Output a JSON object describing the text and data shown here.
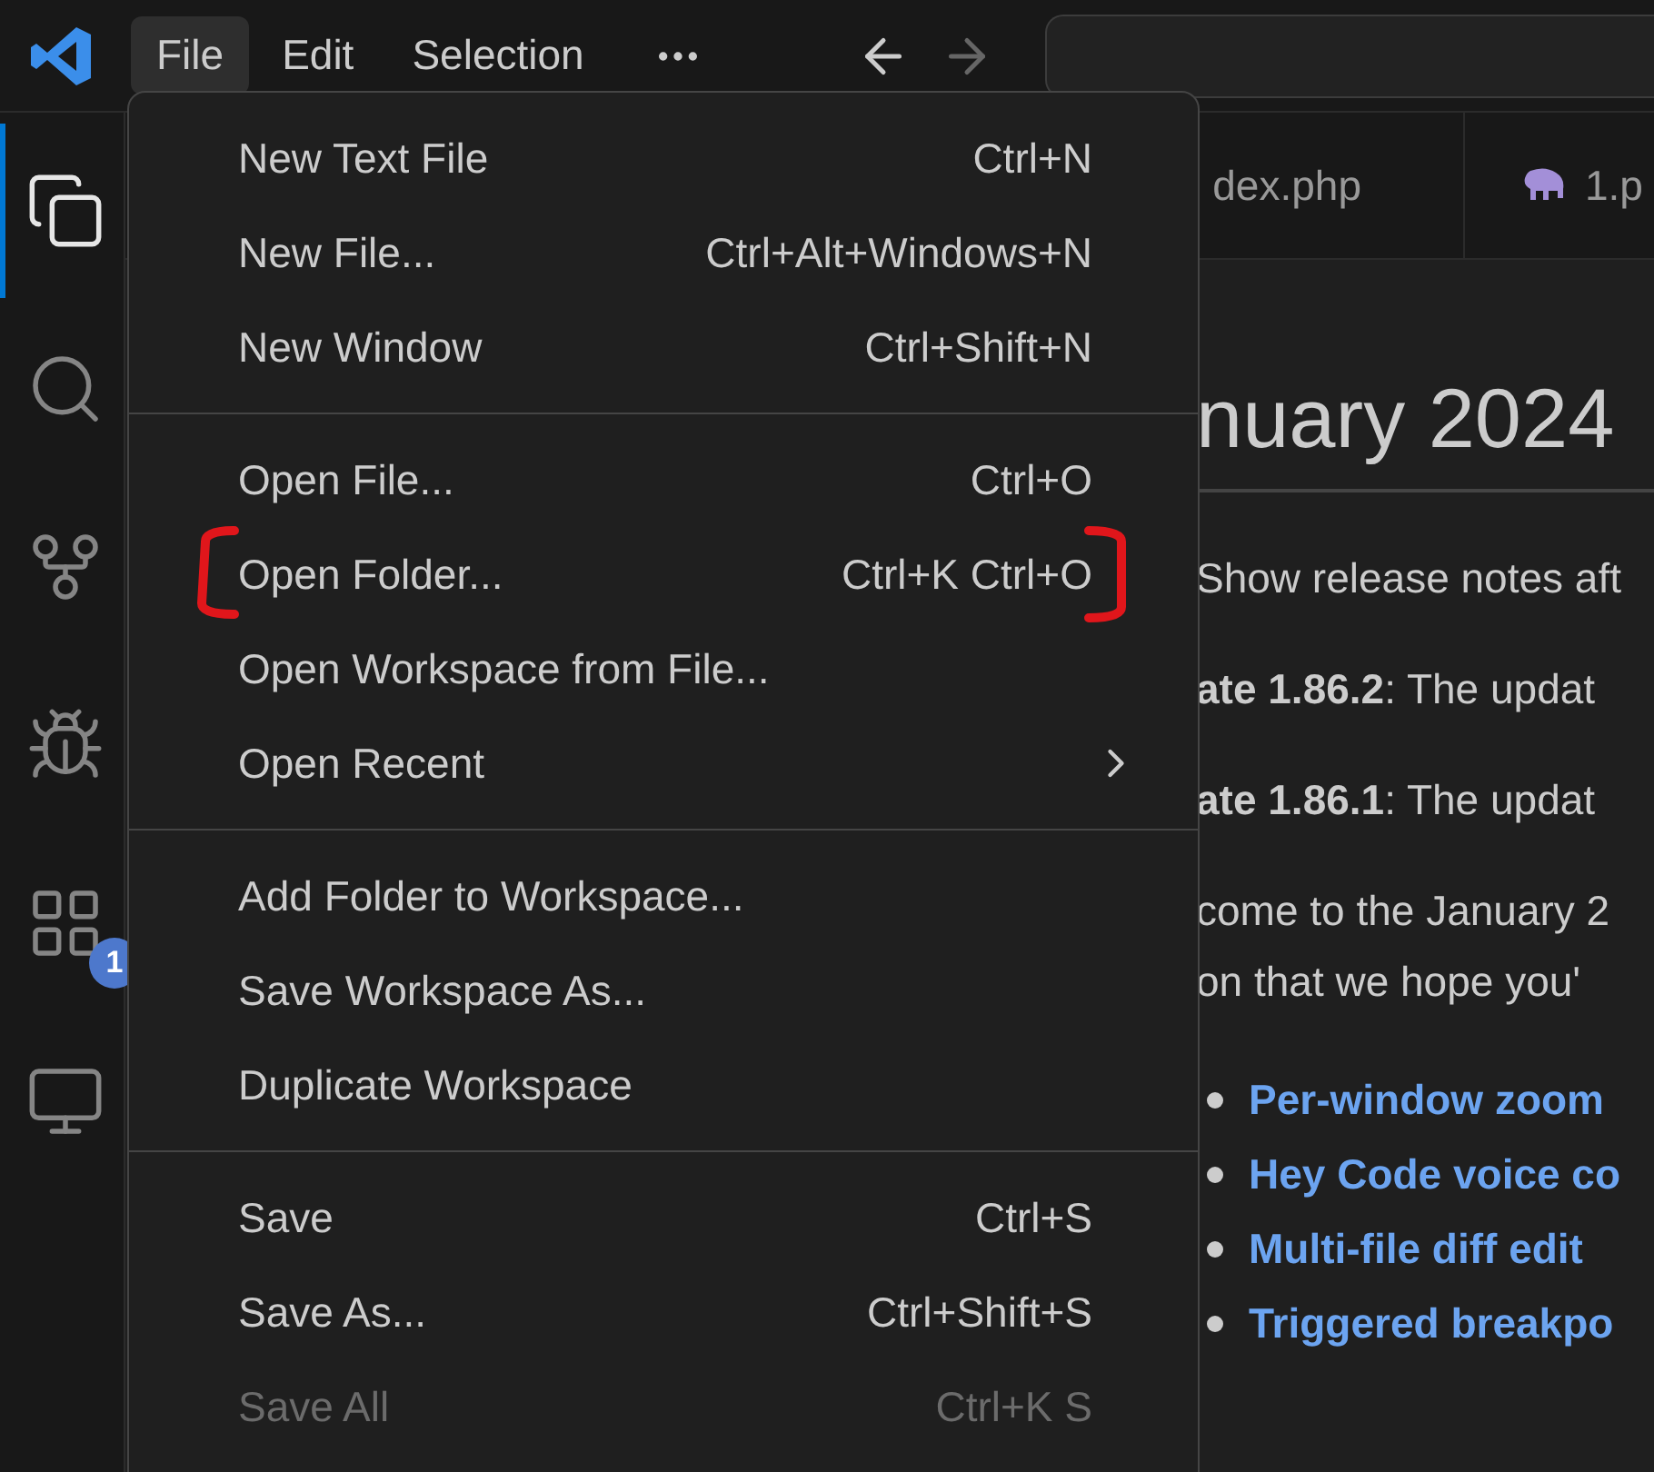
{
  "menubar": [
    {
      "label": "File",
      "selected": true
    },
    {
      "label": "Edit",
      "selected": false
    },
    {
      "label": "Selection",
      "selected": false
    }
  ],
  "activity_bar": {
    "items": [
      {
        "kind": "files",
        "selected": true
      },
      {
        "kind": "search",
        "selected": false
      },
      {
        "kind": "source-control",
        "selected": false
      },
      {
        "kind": "debug",
        "selected": false
      },
      {
        "kind": "extensions",
        "selected": false,
        "badge": "1"
      },
      {
        "kind": "remote",
        "selected": false
      }
    ]
  },
  "tabs": [
    {
      "label": "dex.php",
      "kind": "plain"
    },
    {
      "label": "1.p",
      "kind": "php"
    }
  ],
  "editor": {
    "heading": "nuary 2024",
    "paragraphs": [
      "Show release notes aft",
      "**ate 1.86.2**: The updat",
      "**ate 1.86.1**: The updat"
    ],
    "welcome": [
      "come to the January 2",
      "on that we hope you'"
    ],
    "links": [
      "Per-window zoom",
      "Hey Code voice co",
      "Multi-file diff edit",
      "Triggered breakpo"
    ]
  },
  "file_menu": {
    "groups": [
      [
        {
          "label": "New Text File",
          "shortcut": "Ctrl+N",
          "disabled": false,
          "submenu": false,
          "highlighted": false
        },
        {
          "label": "New File...",
          "shortcut": "Ctrl+Alt+Windows+N",
          "disabled": false,
          "submenu": false,
          "highlighted": false
        },
        {
          "label": "New Window",
          "shortcut": "Ctrl+Shift+N",
          "disabled": false,
          "submenu": false,
          "highlighted": false
        }
      ],
      [
        {
          "label": "Open File...",
          "shortcut": "Ctrl+O",
          "disabled": false,
          "submenu": false,
          "highlighted": false
        },
        {
          "label": "Open Folder...",
          "shortcut": "Ctrl+K Ctrl+O",
          "disabled": false,
          "submenu": false,
          "highlighted": true
        },
        {
          "label": "Open Workspace from File...",
          "disabled": false,
          "submenu": false,
          "highlighted": false
        },
        {
          "label": "Open Recent",
          "disabled": false,
          "submenu": true,
          "highlighted": false
        }
      ],
      [
        {
          "label": "Add Folder to Workspace...",
          "disabled": false,
          "submenu": false,
          "highlighted": false
        },
        {
          "label": "Save Workspace As...",
          "disabled": false,
          "submenu": false,
          "highlighted": false
        },
        {
          "label": "Duplicate Workspace",
          "disabled": false,
          "submenu": false,
          "highlighted": false
        }
      ],
      [
        {
          "label": "Save",
          "shortcut": "Ctrl+S",
          "disabled": false,
          "submenu": false,
          "highlighted": false
        },
        {
          "label": "Save As...",
          "shortcut": "Ctrl+Shift+S",
          "disabled": false,
          "submenu": false,
          "highlighted": false
        },
        {
          "label": "Save All",
          "shortcut": "Ctrl+K S",
          "disabled": true,
          "submenu": false,
          "highlighted": false
        }
      ]
    ]
  }
}
